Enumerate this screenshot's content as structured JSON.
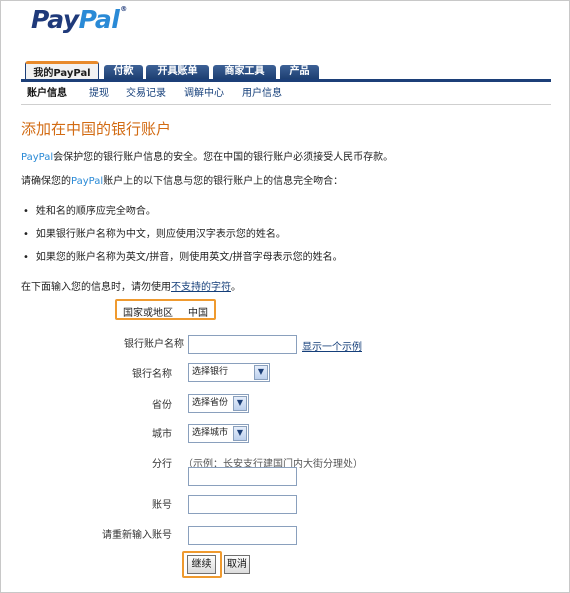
{
  "logo": {
    "pay": "Pay",
    "pal": "Pal",
    "tm": "®"
  },
  "tabs": [
    {
      "label": "我的PayPal",
      "active": true
    },
    {
      "label": "付款"
    },
    {
      "label": "开具账单"
    },
    {
      "label": "商家工具"
    },
    {
      "label": "产品"
    }
  ],
  "subnav": [
    "账户信息",
    "提现",
    "交易记录",
    "调解中心",
    "用户信息"
  ],
  "page_title": "添加在中国的银行账户",
  "intro": {
    "brand": "PayPal",
    "text1": "会保护您的银行账户信息的安全。您在中国的银行账户必须接受人民币存款。",
    "line2_a": "请确保您的",
    "line2_brand": "PayPal",
    "line2_b": "账户上的以下信息与您的银行账户上的信息完全吻合："
  },
  "bullets": [
    "姓和名的顺序应完全吻合。",
    "如果银行账户名称为中文，则应使用汉字表示您的姓名。",
    "如果您的账户名称为英文/拼音，则使用英文/拼音字母表示您的姓名。"
  ],
  "note": {
    "text": "在下面输入您的信息时，请勿使用",
    "link": "不支持的字符",
    "end": "。"
  },
  "form": {
    "country_label": "国家或地区",
    "country_value": "中国",
    "account_name_label": "银行账户名称",
    "show_example": "显示一个示例",
    "bank_name_label": "银行名称",
    "bank_select": "选择银行",
    "province_label": "省份",
    "province_select": "选择省份",
    "city_label": "城市",
    "city_select": "选择城市",
    "branch_label": "分行",
    "branch_hint": "（示例：长安支行建国门内大街分理处）",
    "account_no_label": "账号",
    "reenter_label": "请重新输入账号",
    "continue": "继续",
    "cancel": "取消"
  },
  "colors": {
    "accent": "#d26b13",
    "nav": "#1c3f78",
    "highlight": "#ef9a2f",
    "brand_light": "#2a8ad6"
  }
}
